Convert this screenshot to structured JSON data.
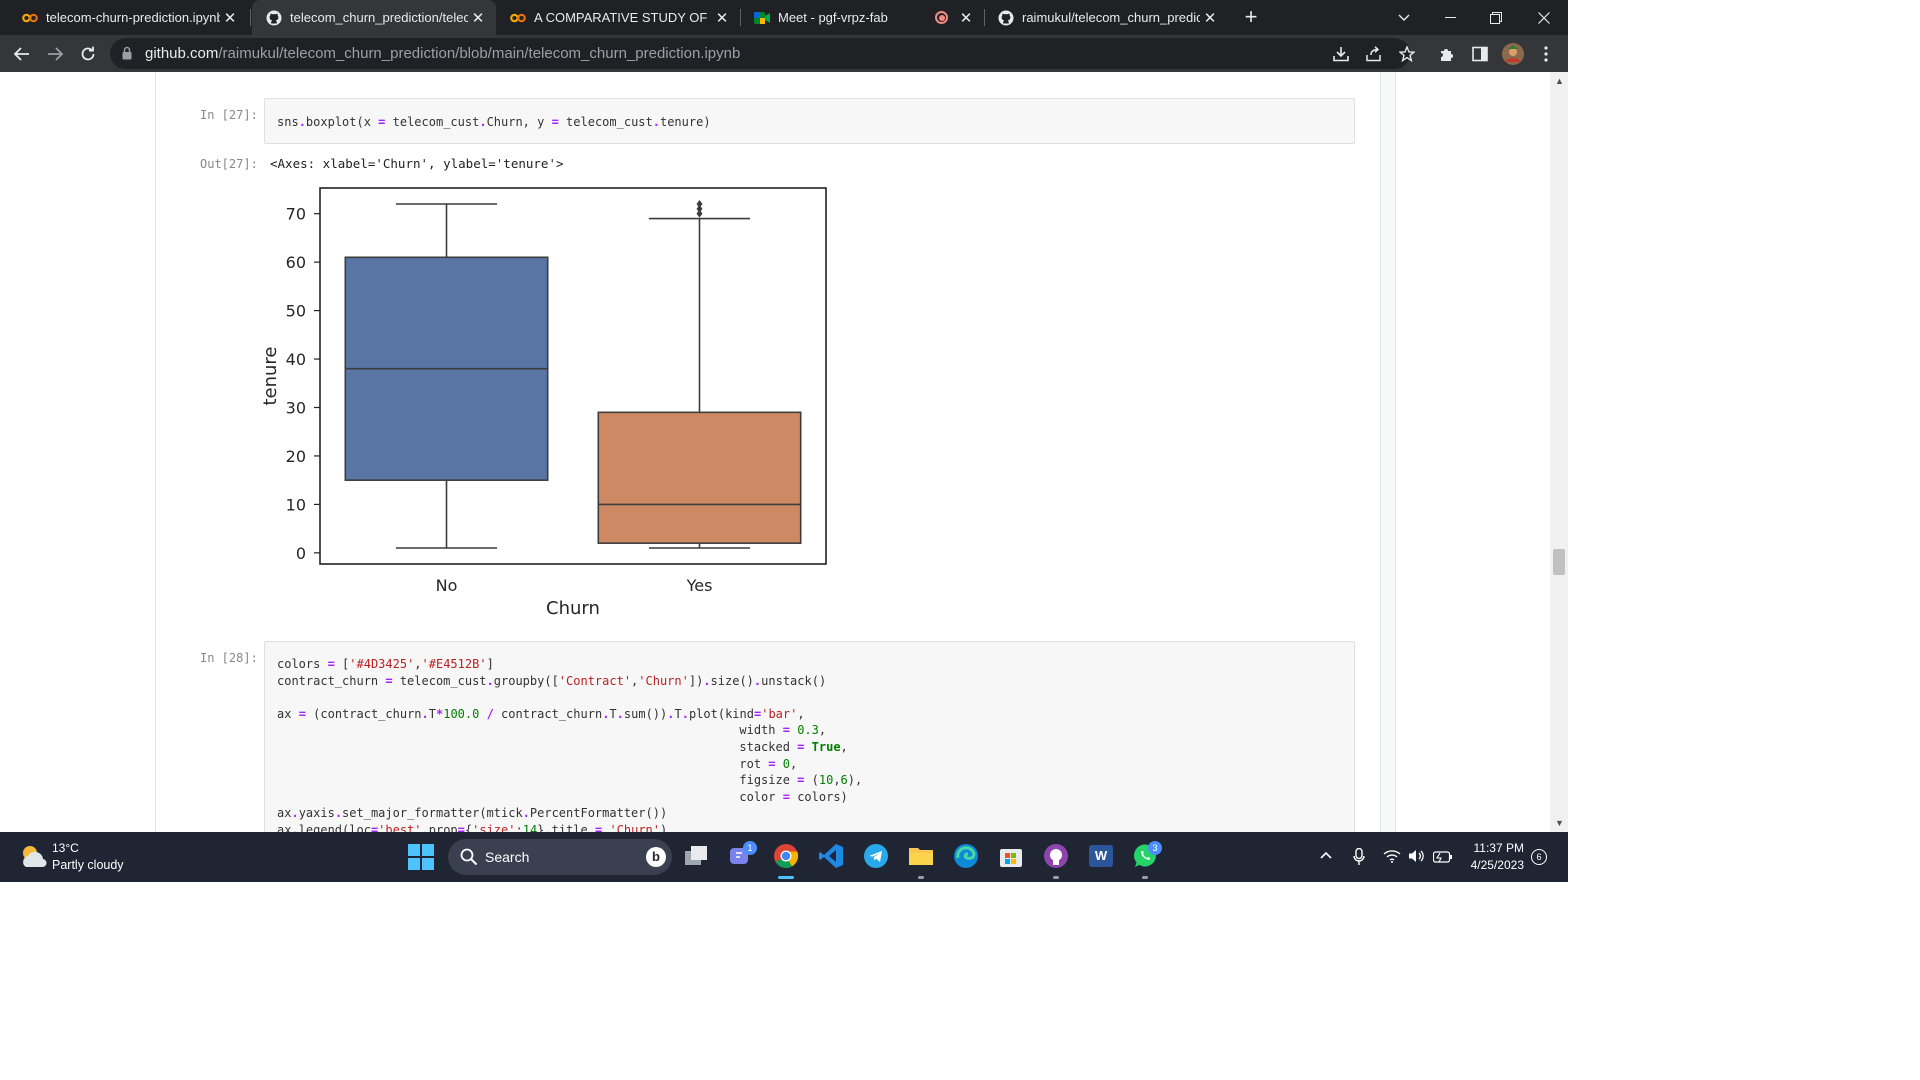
{
  "browser": {
    "tabs": [
      {
        "title": "telecom-churn-prediction.ipynb",
        "icon": "colab-icon",
        "active": false
      },
      {
        "title": "telecom_churn_prediction/teleco",
        "icon": "github-icon",
        "active": true
      },
      {
        "title": "A COMPARATIVE STUDY OF MUL",
        "icon": "colab-icon",
        "active": false
      },
      {
        "title": "Meet - pgf-vrpz-fab",
        "icon": "meet-icon",
        "active": false
      },
      {
        "title": "raimukul/telecom_churn_predicti",
        "icon": "github-icon",
        "active": false
      }
    ],
    "close_glyph": "✕",
    "new_tab_glyph": "+",
    "url_host": "github.com",
    "url_path": "/raimukul/telecom_churn_prediction/blob/main/telecom_churn_prediction.ipynb"
  },
  "notebook": {
    "cell27": {
      "in_prompt": "In [27]:",
      "out_prompt": "Out[27]:",
      "output_text": "<Axes: xlabel='Churn', ylabel='tenure'>"
    },
    "cell28": {
      "in_prompt": "In [28]:"
    }
  },
  "chart_data": {
    "type": "boxplot",
    "xlabel": "Churn",
    "ylabel": "tenure",
    "categories": [
      "No",
      "Yes"
    ],
    "yticks": [
      0,
      10,
      20,
      30,
      40,
      50,
      60,
      70
    ],
    "ylim": [
      -2.3,
      75.3
    ],
    "boxes": [
      {
        "category": "No",
        "color": "#5875a4",
        "whisker_low": 1,
        "q1": 15,
        "median": 38,
        "q3": 61,
        "whisker_high": 72,
        "outliers": []
      },
      {
        "category": "Yes",
        "color": "#cc8963",
        "whisker_low": 1,
        "q1": 2,
        "median": 10,
        "q3": 29,
        "whisker_high": 69,
        "outliers": [
          70,
          71,
          72
        ]
      }
    ]
  },
  "taskbar": {
    "weather_temp": "13°C",
    "weather_desc": "Partly cloudy",
    "search_label": "Search",
    "bing_letter": "b",
    "teams_badge": "1",
    "whatsapp_badge": "3",
    "word_letter": "W",
    "clock_time": "11:37 PM",
    "clock_date": "4/25/2023",
    "notification_count": "6"
  }
}
